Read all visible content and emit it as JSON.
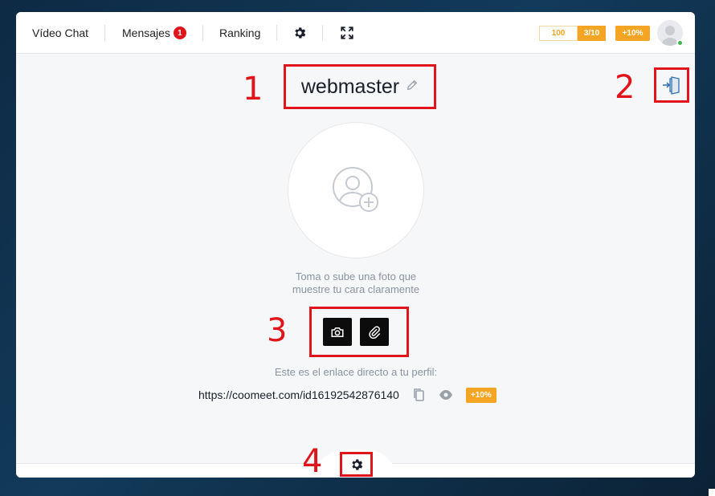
{
  "nav": {
    "video_chat": "Vídeo Chat",
    "messages": "Mensajes",
    "messages_count": "1",
    "ranking": "Ranking"
  },
  "stats": {
    "coins": "100",
    "level": "3/10",
    "bonus": "+10%"
  },
  "profile": {
    "username": "webmaster",
    "photo_hint_line1": "Toma o sube una foto que",
    "photo_hint_line2": "muestre tu cara claramente",
    "link_label": "Este es el enlace directo a tu perfil:",
    "link_url": "https://coomeet.com/id16192542876140",
    "link_bonus": "+10%"
  },
  "annotations": {
    "n1": "1",
    "n2": "2",
    "n3": "3",
    "n4": "4"
  },
  "icons": {
    "settings": "gear-icon",
    "fullscreen": "fullscreen-icon",
    "edit": "pencil-icon",
    "logout": "logout-door-icon",
    "add_photo": "add-user-photo-icon",
    "camera": "camera-icon",
    "attach": "paperclip-icon",
    "copy": "copy-icon",
    "view": "eye-icon"
  },
  "colors": {
    "accent": "#f5a524",
    "badge_red": "#e0141b",
    "online": "#3fb54a",
    "button_dark": "#0c0c0c"
  }
}
